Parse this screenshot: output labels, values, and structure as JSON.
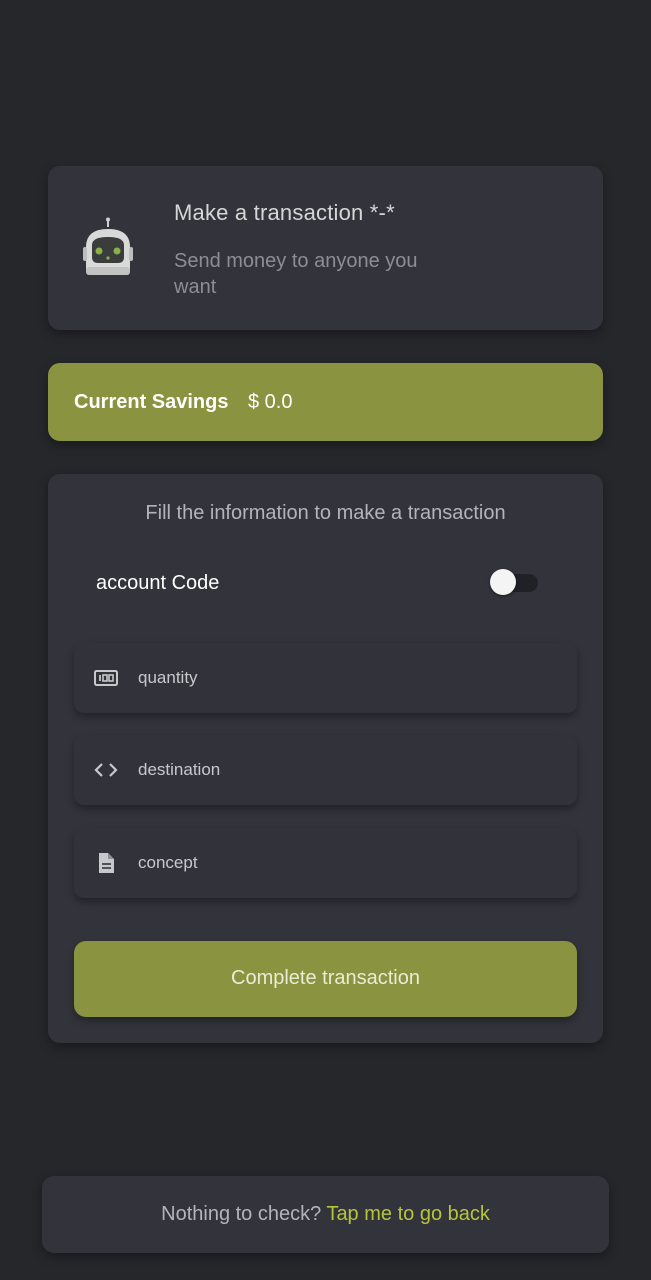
{
  "header": {
    "title": "Make a transaction *-*",
    "subtitle": "Send money to anyone you want",
    "icon": "robot-icon"
  },
  "savings": {
    "label": "Current Savings",
    "value": "$ 0.0"
  },
  "form": {
    "title": "Fill the information to make a transaction",
    "account_code_label": "account Code",
    "account_code_toggle_on": false,
    "fields": [
      {
        "icon": "numeric-100-icon",
        "placeholder": "quantity"
      },
      {
        "icon": "code-brackets-icon",
        "placeholder": "destination"
      },
      {
        "icon": "document-icon",
        "placeholder": "concept"
      }
    ],
    "submit_label": "Complete transaction"
  },
  "footer": {
    "text": "Nothing to check?",
    "link": "Tap me to go back"
  },
  "colors": {
    "background": "#26272b",
    "card": "#33343b",
    "accent": "#8a9340",
    "link": "#b6c43a"
  }
}
